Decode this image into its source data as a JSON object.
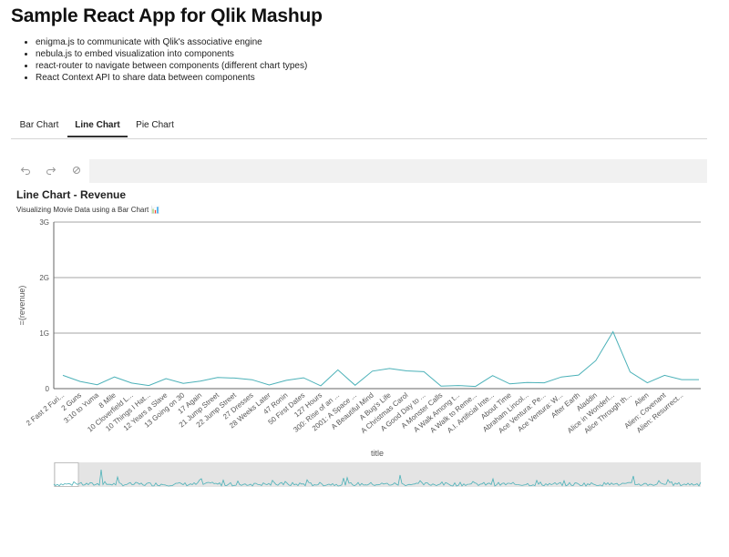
{
  "header": {
    "title": "Sample React App for Qlik Mashup",
    "features": [
      "enigma.js to communicate with Qlik's associative engine",
      "nebula.js to embed visualization into components",
      "react-router to navigate between components (different chart types)",
      "React Context API to share data between components"
    ]
  },
  "tabs": [
    {
      "label": "Bar Chart",
      "active": false
    },
    {
      "label": "Line Chart",
      "active": true
    },
    {
      "label": "Pie Chart",
      "active": false
    }
  ],
  "toolbar": {
    "icons": [
      "undo-icon",
      "redo-icon",
      "clear-selections-icon"
    ]
  },
  "chart": {
    "title": "Line Chart - Revenue",
    "subtitle": "Visualizing Movie Data using a Bar Chart",
    "subtitle_emoji": "📊",
    "line_color": "#4bb1b8"
  },
  "chart_data": {
    "type": "line",
    "xlabel": "title",
    "ylabel": "=(revenue)",
    "ylim": [
      0,
      3000000000
    ],
    "yticks": [
      {
        "value": 0,
        "label": "0"
      },
      {
        "value": 1000000000,
        "label": "1G"
      },
      {
        "value": 2000000000,
        "label": "2G"
      },
      {
        "value": 3000000000,
        "label": "3G"
      }
    ],
    "grid": true,
    "categories": [
      "2 Fast 2 Furi...",
      "2 Guns",
      "3:10 to Yuma",
      "8 Mile",
      "10 Cloverfield L...",
      "10 Things I Hat...",
      "12 Years a Slave",
      "13 Going on 30",
      "17 Again",
      "21 Jump Street",
      "22 Jump Street",
      "27 Dresses",
      "28 Weeks Later",
      "47 Ronin",
      "50 First Dates",
      "127 Hours",
      "300: Rise of an ...",
      "2001: A Space ...",
      "A Beautiful Mind",
      "A Bug's Life",
      "A Christmas Carol",
      "A Good Day to ...",
      "A Monster Calls",
      "A Walk Among t...",
      "A Walk to Reme...",
      "A.I. Artificial Inte...",
      "About Time",
      "Abraham Lincol...",
      "Ace Ventura: Pe...",
      "Ace Ventura: W...",
      "After Earth",
      "Aladdin",
      "Alice in Wonderl...",
      "Alice Through th...",
      "Alien",
      "Alien: Covenant",
      "Alien: Resurrect..."
    ],
    "series": [
      {
        "values": [
          240000000,
          130000000,
          70000000,
          210000000,
          100000000,
          55000000,
          180000000,
          95000000,
          135000000,
          200000000,
          190000000,
          160000000,
          65000000,
          150000000,
          195000000,
          50000000,
          337000000,
          60000000,
          315000000,
          363000000,
          320000000,
          305000000,
          45000000,
          55000000,
          40000000,
          235000000,
          85000000,
          110000000,
          105000000,
          210000000,
          245000000,
          505000000,
          1025000000,
          300000000,
          105000000,
          240000000,
          162000000,
          162000000
        ]
      }
    ]
  }
}
